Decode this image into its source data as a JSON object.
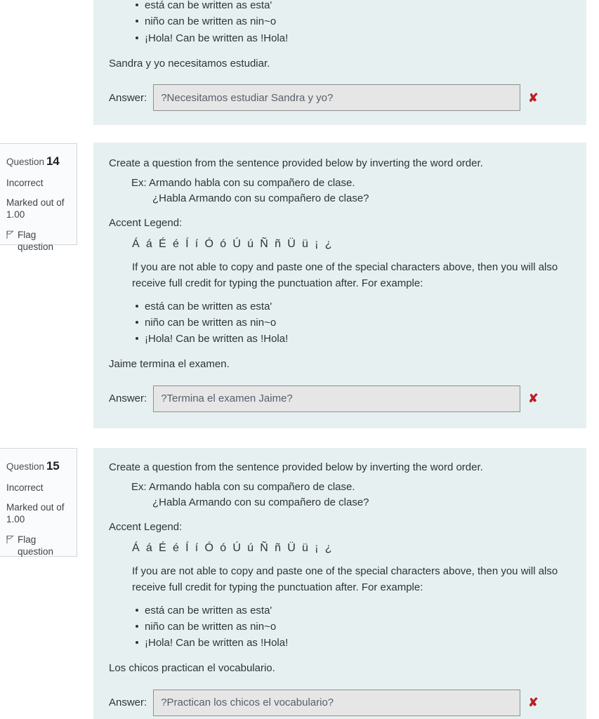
{
  "colors": {
    "page_background": "#ffffff",
    "question_panel": "#e7f0f0",
    "info_box_background": "#fafbfc",
    "info_box_border": "#d3d6d9",
    "input_background": "#e6e6e6",
    "input_border": "#8b8f93",
    "incorrect_mark": "#b91f28",
    "text": "#2e3338"
  },
  "common": {
    "instruction": "Create a question from the sentence provided below by inverting the word order.",
    "example_prompt": "Ex: Armando habla con su compañero de clase.",
    "example_answer": "¿Habla Armando con su compañero de clase?",
    "legend_title": "Accent Legend:",
    "legend_chars": "Á á É é Í í Ó ó Ú ú Ñ ñ Ü ü ¡ ¿",
    "note": "If you are not able to copy and paste one of the special characters above, then you will also receive full credit for typing the punctuation after. For example:",
    "bullets": [
      "está can be written as esta'",
      "niño can be written as nin~o",
      "¡Hola! Can be written as !Hola!"
    ],
    "answer_label": "Answer:",
    "incorrect_mark_glyph": "✘",
    "state_label": "Incorrect",
    "grade_label": "Marked out of 1.00",
    "grade_line1": "Marked out of",
    "grade_line2": "1.00",
    "flag_label": "Flag question",
    "question_word": "Question"
  },
  "questions": [
    {
      "number": "",
      "partial": true,
      "bullets_visible": [
        "está can be written as esta'",
        "niño can be written as nin~o",
        "¡Hola! Can be written as !Hola!"
      ],
      "sentence": "Sandra y yo necesitamos estudiar.",
      "answer_value": "?Necesitamos estudiar Sandra y yo?",
      "answer_placeholder": "",
      "result": "incorrect"
    },
    {
      "number": "14",
      "partial": false,
      "state": "Incorrect",
      "grade": "Marked out of 1.00",
      "sentence": "Jaime termina el examen.",
      "answer_value": "?Termina el examen Jaime?",
      "answer_placeholder": "",
      "result": "incorrect"
    },
    {
      "number": "15",
      "partial": false,
      "state": "Incorrect",
      "grade": "Marked out of 1.00",
      "sentence": "Los chicos practican el vocabulario.",
      "answer_value": "?Practican los chicos el vocabulario?",
      "answer_placeholder": "",
      "result": "incorrect"
    }
  ]
}
